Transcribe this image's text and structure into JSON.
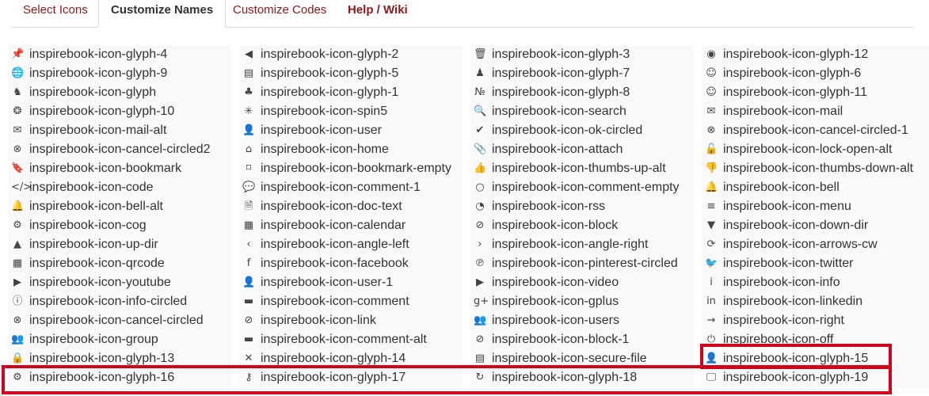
{
  "tabs": [
    {
      "label": "Select Icons",
      "active": false
    },
    {
      "label": "Customize Names",
      "active": true
    },
    {
      "label": "Customize Codes",
      "active": false
    },
    {
      "label": "Help / Wiki",
      "active": false
    }
  ],
  "accent_color": "#8b1a1a",
  "highlight_color": "#d0021b",
  "columns": [
    [
      {
        "name": "inspirebook-icon-glyph-4",
        "icon": "pin-icon"
      },
      {
        "name": "inspirebook-icon-glyph-9",
        "icon": "globe-icon"
      },
      {
        "name": "inspirebook-icon-glyph",
        "icon": "animal-icon"
      },
      {
        "name": "inspirebook-icon-glyph-10",
        "icon": "badge-icon"
      },
      {
        "name": "inspirebook-icon-mail-alt",
        "icon": "mail-alt-icon"
      },
      {
        "name": "inspirebook-icon-cancel-circled2",
        "icon": "cancel-circled2-icon"
      },
      {
        "name": "inspirebook-icon-bookmark",
        "icon": "bookmark-icon"
      },
      {
        "name": "inspirebook-icon-code",
        "icon": "code-icon"
      },
      {
        "name": "inspirebook-icon-bell-alt",
        "icon": "bell-alt-icon"
      },
      {
        "name": "inspirebook-icon-cog",
        "icon": "cog-icon"
      },
      {
        "name": "inspirebook-icon-up-dir",
        "icon": "up-dir-icon"
      },
      {
        "name": "inspirebook-icon-qrcode",
        "icon": "qrcode-icon"
      },
      {
        "name": "inspirebook-icon-youtube",
        "icon": "youtube-icon"
      },
      {
        "name": "inspirebook-icon-info-circled",
        "icon": "info-circled-icon"
      },
      {
        "name": "inspirebook-icon-cancel-circled",
        "icon": "cancel-circled-icon"
      },
      {
        "name": "inspirebook-icon-group",
        "icon": "group-icon"
      },
      {
        "name": "inspirebook-icon-glyph-13",
        "icon": "lock-icon"
      },
      {
        "name": "inspirebook-icon-glyph-16",
        "icon": "gear-icon"
      }
    ],
    [
      {
        "name": "inspirebook-icon-glyph-2",
        "icon": "back-circle-icon"
      },
      {
        "name": "inspirebook-icon-glyph-5",
        "icon": "id-card-icon"
      },
      {
        "name": "inspirebook-icon-glyph-1",
        "icon": "tree-icon"
      },
      {
        "name": "inspirebook-icon-spin5",
        "icon": "spinner-icon"
      },
      {
        "name": "inspirebook-icon-user",
        "icon": "user-icon"
      },
      {
        "name": "inspirebook-icon-home",
        "icon": "home-icon"
      },
      {
        "name": "inspirebook-icon-bookmark-empty",
        "icon": "bookmark-empty-icon"
      },
      {
        "name": "inspirebook-icon-comment-1",
        "icon": "comment-icon"
      },
      {
        "name": "inspirebook-icon-doc-text",
        "icon": "document-icon"
      },
      {
        "name": "inspirebook-icon-calendar",
        "icon": "calendar-icon"
      },
      {
        "name": "inspirebook-icon-angle-left",
        "icon": "angle-left-icon"
      },
      {
        "name": "inspirebook-icon-facebook",
        "icon": "facebook-icon"
      },
      {
        "name": "inspirebook-icon-user-1",
        "icon": "user-1-icon"
      },
      {
        "name": "inspirebook-icon-comment",
        "icon": "comment-filled-icon"
      },
      {
        "name": "inspirebook-icon-link",
        "icon": "link-icon"
      },
      {
        "name": "inspirebook-icon-comment-alt",
        "icon": "comment-alt-icon"
      },
      {
        "name": "inspirebook-icon-glyph-14",
        "icon": "close-icon"
      },
      {
        "name": "inspirebook-icon-glyph-17",
        "icon": "key-icon"
      }
    ],
    [
      {
        "name": "inspirebook-icon-glyph-3",
        "icon": "trash-icon"
      },
      {
        "name": "inspirebook-icon-glyph-7",
        "icon": "people-icon"
      },
      {
        "name": "inspirebook-icon-glyph-8",
        "icon": "numbered-icon"
      },
      {
        "name": "inspirebook-icon-search",
        "icon": "search-icon"
      },
      {
        "name": "inspirebook-icon-ok-circled",
        "icon": "check-circle-icon"
      },
      {
        "name": "inspirebook-icon-attach",
        "icon": "paperclip-icon"
      },
      {
        "name": "inspirebook-icon-thumbs-up-alt",
        "icon": "thumbs-up-icon"
      },
      {
        "name": "inspirebook-icon-comment-empty",
        "icon": "comment-empty-icon"
      },
      {
        "name": "inspirebook-icon-rss",
        "icon": "rss-icon"
      },
      {
        "name": "inspirebook-icon-block",
        "icon": "block-icon"
      },
      {
        "name": "inspirebook-icon-angle-right",
        "icon": "angle-right-icon"
      },
      {
        "name": "inspirebook-icon-pinterest-circled",
        "icon": "pinterest-icon"
      },
      {
        "name": "inspirebook-icon-video",
        "icon": "video-icon"
      },
      {
        "name": "inspirebook-icon-gplus",
        "icon": "gplus-icon"
      },
      {
        "name": "inspirebook-icon-users",
        "icon": "users-icon"
      },
      {
        "name": "inspirebook-icon-block-1",
        "icon": "block-1-icon"
      },
      {
        "name": "inspirebook-icon-secure-file",
        "icon": "secure-file-icon"
      },
      {
        "name": "inspirebook-icon-glyph-18",
        "icon": "refresh-icon"
      }
    ],
    [
      {
        "name": "inspirebook-icon-glyph-12",
        "icon": "location-icon"
      },
      {
        "name": "inspirebook-icon-glyph-6",
        "icon": "face-icon"
      },
      {
        "name": "inspirebook-icon-glyph-11",
        "icon": "face-alt-icon"
      },
      {
        "name": "inspirebook-icon-mail",
        "icon": "mail-icon"
      },
      {
        "name": "inspirebook-icon-cancel-circled-1",
        "icon": "cancel-circled-1-icon"
      },
      {
        "name": "inspirebook-icon-lock-open-alt",
        "icon": "lock-open-icon"
      },
      {
        "name": "inspirebook-icon-thumbs-down-alt",
        "icon": "thumbs-down-icon"
      },
      {
        "name": "inspirebook-icon-bell",
        "icon": "bell-icon"
      },
      {
        "name": "inspirebook-icon-menu",
        "icon": "menu-icon"
      },
      {
        "name": "inspirebook-icon-down-dir",
        "icon": "down-dir-icon"
      },
      {
        "name": "inspirebook-icon-arrows-cw",
        "icon": "arrows-cw-icon"
      },
      {
        "name": "inspirebook-icon-twitter",
        "icon": "twitter-icon"
      },
      {
        "name": "inspirebook-icon-info",
        "icon": "info-icon"
      },
      {
        "name": "inspirebook-icon-linkedin",
        "icon": "linkedin-icon"
      },
      {
        "name": "inspirebook-icon-right",
        "icon": "arrow-right-icon"
      },
      {
        "name": "inspirebook-icon-off",
        "icon": "power-icon"
      },
      {
        "name": "inspirebook-icon-glyph-15",
        "icon": "person-icon"
      },
      {
        "name": "inspirebook-icon-glyph-19",
        "icon": "monitor-icon"
      }
    ]
  ]
}
